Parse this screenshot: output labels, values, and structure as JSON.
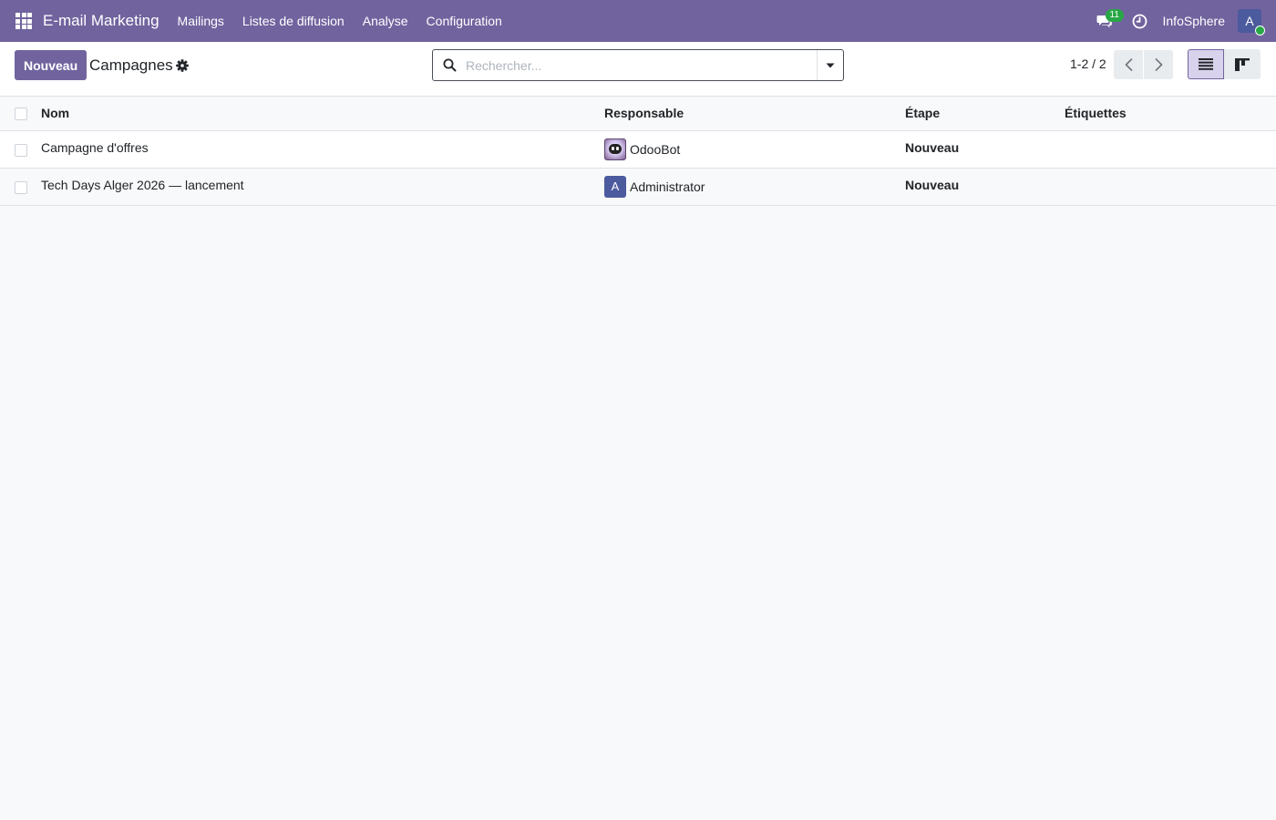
{
  "navbar": {
    "app_name": "E-mail Marketing",
    "menu": [
      "Mailings",
      "Listes de diffusion",
      "Analyse",
      "Configuration"
    ],
    "chat_count": "11",
    "company": "InfoSphere",
    "user_initial": "A",
    "accent_color": "#71639e"
  },
  "control_panel": {
    "new_label": "Nouveau",
    "title": "Campagnes",
    "search_placeholder": "Rechercher...",
    "pager": "1-2 / 2"
  },
  "table": {
    "columns": [
      "Nom",
      "Responsable",
      "Étape",
      "Étiquettes"
    ],
    "rows": [
      {
        "name": "Campagne d'offres",
        "responsible": "OdooBot",
        "avatar": "odoobot",
        "stage": "Nouveau",
        "tags": ""
      },
      {
        "name": "Tech Days Alger 2026 — lancement",
        "responsible": "Administrator",
        "avatar": "A",
        "stage": "Nouveau",
        "tags": ""
      }
    ]
  }
}
